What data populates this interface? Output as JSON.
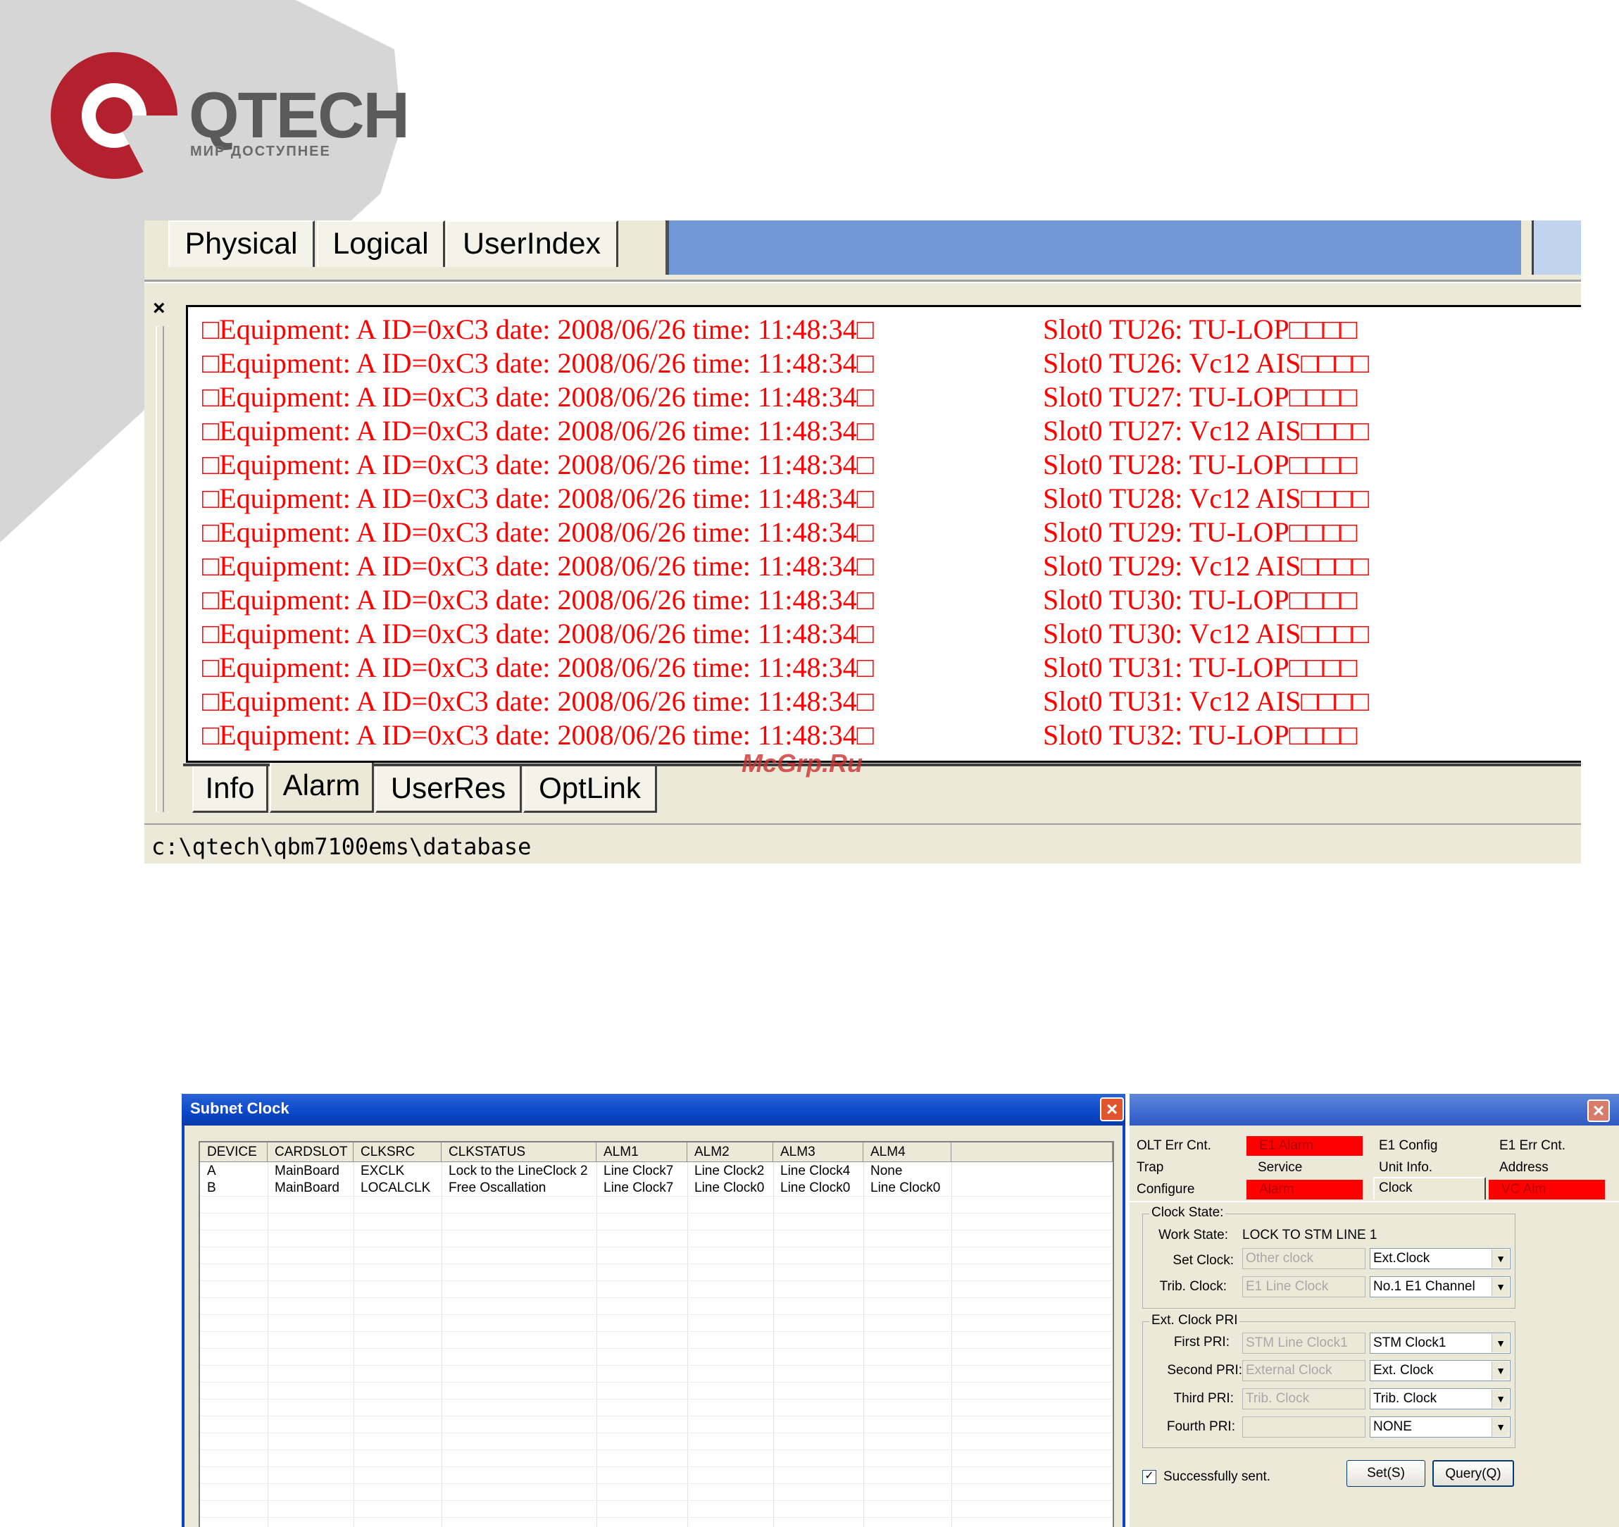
{
  "logo": {
    "name": "QTECH",
    "tagline": "МИР ДОСТУПНЕЕ"
  },
  "colors": {
    "alarm_text": "#ff0000",
    "accent_blue": "#7198d6",
    "brand_red": "#b3202e"
  },
  "top_window": {
    "tabs_top": [
      "Physical",
      "Logical",
      "UserIndex"
    ],
    "close_label": "×",
    "log_rows": [
      {
        "left": "□Equipment: A  ID=0xC3  date: 2008/06/26 time: 11:48:34□",
        "right": "Slot0 TU26: TU-LOP□□□□"
      },
      {
        "left": "□Equipment: A  ID=0xC3  date: 2008/06/26 time: 11:48:34□",
        "right": "Slot0 TU26: Vc12 AIS□□□□"
      },
      {
        "left": "□Equipment: A  ID=0xC3  date: 2008/06/26 time: 11:48:34□",
        "right": "Slot0 TU27: TU-LOP□□□□"
      },
      {
        "left": "□Equipment: A  ID=0xC3  date: 2008/06/26 time: 11:48:34□",
        "right": "Slot0 TU27: Vc12 AIS□□□□"
      },
      {
        "left": "□Equipment: A  ID=0xC3  date: 2008/06/26 time: 11:48:34□",
        "right": "Slot0 TU28: TU-LOP□□□□"
      },
      {
        "left": "□Equipment: A  ID=0xC3  date: 2008/06/26 time: 11:48:34□",
        "right": "Slot0 TU28: Vc12 AIS□□□□"
      },
      {
        "left": "□Equipment: A  ID=0xC3  date: 2008/06/26 time: 11:48:34□",
        "right": "Slot0 TU29: TU-LOP□□□□"
      },
      {
        "left": "□Equipment: A  ID=0xC3  date: 2008/06/26 time: 11:48:34□",
        "right": "Slot0 TU29: Vc12 AIS□□□□"
      },
      {
        "left": "□Equipment: A  ID=0xC3  date: 2008/06/26 time: 11:48:34□",
        "right": "Slot0 TU30: TU-LOP□□□□"
      },
      {
        "left": "□Equipment: A  ID=0xC3  date: 2008/06/26 time: 11:48:34□",
        "right": "Slot0 TU30: Vc12 AIS□□□□"
      },
      {
        "left": "□Equipment: A  ID=0xC3  date: 2008/06/26 time: 11:48:34□",
        "right": "Slot0 TU31: TU-LOP□□□□"
      },
      {
        "left": "□Equipment: A  ID=0xC3  date: 2008/06/26 time: 11:48:34□",
        "right": "Slot0 TU31: Vc12 AIS□□□□"
      },
      {
        "left": "□Equipment: A  ID=0xC3  date: 2008/06/26 time: 11:48:34□",
        "right": "Slot0 TU32: TU-LOP□□□□"
      }
    ],
    "tabs_bottom": [
      "Info",
      "Alarm",
      "UserRes",
      "OptLink"
    ],
    "status_path": "c:\\qtech\\qbm7100ems\\database"
  },
  "watermark": "McGrp.Ru",
  "subnet_clock": {
    "title": "Subnet Clock",
    "columns": [
      "DEVICE",
      "CARDSLOT",
      "CLKSRC",
      "CLKSTATUS",
      "ALM1",
      "ALM2",
      "ALM3",
      "ALM4"
    ],
    "rows": [
      [
        "A",
        "MainBoard",
        "EXCLK",
        "Lock to the LineClock 2",
        "Line Clock7",
        "Line Clock2",
        "Line Clock4",
        "None"
      ],
      [
        "B",
        "MainBoard",
        "LOCALCLK",
        "Free Oscallation",
        "Line Clock7",
        "Line Clock0",
        "Line Clock0",
        "Line Clock0"
      ]
    ]
  },
  "config_panel": {
    "tabs_row1": [
      "OLT Err Cnt.",
      "E1 Alarm",
      "E1 Config",
      "E1 Err Cnt."
    ],
    "tabs_row2": [
      "Trap",
      "Service",
      "Unit Info.",
      "Address"
    ],
    "tabs_row3": [
      "Configure",
      "Alarm",
      "Clock",
      "VC Alm"
    ],
    "clock_state": {
      "group_label": "Clock State:",
      "work_state_label": "Work State:",
      "work_state_value": "LOCK TO STM LINE 1",
      "set_clock_label": "Set Clock:",
      "set_clock_current": "Other clock",
      "set_clock_value": "Ext.Clock",
      "trib_clock_label": "Trib. Clock:",
      "trib_clock_current": "E1 Line Clock",
      "trib_clock_value": "No.1 E1 Channel"
    },
    "ext_clock_pri": {
      "group_label": "Ext. Clock PRI",
      "first_label": "First PRI:",
      "first_current": "STM Line Clock1",
      "first_value": "STM Clock1",
      "second_label": "Second PRI:",
      "second_current": "External Clock",
      "second_value": "Ext. Clock",
      "third_label": "Third PRI:",
      "third_current": "Trib. Clock",
      "third_value": "Trib. Clock",
      "fourth_label": "Fourth PRI:",
      "fourth_current": "",
      "fourth_value": "NONE"
    },
    "sent_check": "✓",
    "sent_label": "Successfully sent.",
    "set_button": "Set(S)",
    "query_button": "Query(Q)"
  }
}
